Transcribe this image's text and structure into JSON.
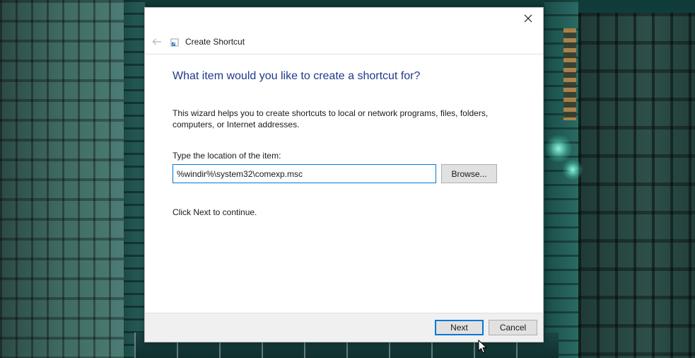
{
  "dialog": {
    "title": "Create Shortcut",
    "heading": "What item would you like to create a shortcut for?",
    "description": "This wizard helps you to create shortcuts to local or network programs, files, folders, computers, or Internet addresses.",
    "location_label": "Type the location of the item:",
    "location_value": "%windir%\\system32\\comexp.msc",
    "browse_label": "Browse...",
    "instruction": "Click Next to continue.",
    "next_label": "Next",
    "cancel_label": "Cancel"
  },
  "icons": {
    "close": "close-icon",
    "back": "back-arrow-icon",
    "wizard": "shortcut-wizard-icon",
    "cursor": "mouse-pointer-icon"
  },
  "colors": {
    "heading": "#1e3a8a",
    "focus_border": "#0078d7",
    "footer_bg": "#f0f0f0",
    "button_bg": "#e1e1e1"
  }
}
